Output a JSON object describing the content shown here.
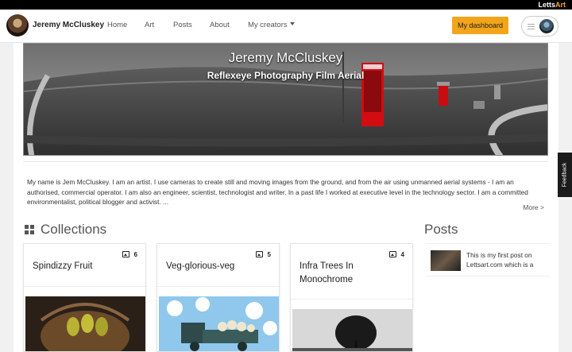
{
  "brand": {
    "prefix": "Letts",
    "suffix": "Art",
    "accent": "#f5a623"
  },
  "nav": {
    "user_name": "Jeremy McCluskey",
    "links": [
      "Home",
      "Art",
      "Posts",
      "About",
      "My creators"
    ],
    "dashboard_label": "My dashboard",
    "dashboard_color": "#f2a51a"
  },
  "banner": {
    "title": "Jeremy McCluskey",
    "subtitle": "Reflexeye Photography Film Aerial"
  },
  "bio": {
    "text": "My name is Jem McCluskey. I am an artist. I use cameras to create still and moving images from the ground, and from the air using unmanned aerial systems - I am an authorised, commercial operator. I am also an engineer, scientist, technologist and writer. In a past life I worked at executive level in the technology sector. I am a committed environmentalist, political blogger and activist. ...",
    "more_label": "More >"
  },
  "collections": {
    "heading": "Collections",
    "items": [
      {
        "title": "Spindizzy Fruit",
        "count": "6"
      },
      {
        "title": "Veg-glorious-veg",
        "count": "5"
      },
      {
        "title": "Infra Trees In Monochrome",
        "count": "4"
      }
    ]
  },
  "posts": {
    "heading": "Posts",
    "items": [
      {
        "excerpt": "This is my first post on Lettsart.com which is a"
      }
    ]
  },
  "feedback_label": "Feedback"
}
